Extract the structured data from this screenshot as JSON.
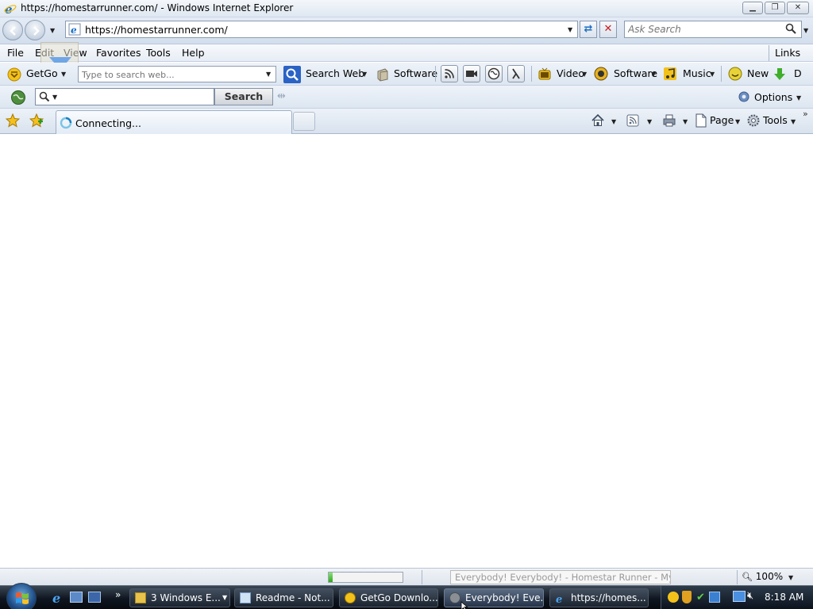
{
  "window": {
    "title": "https://homestarrunner.com/ - Windows Internet Explorer",
    "controls": [
      "minimize",
      "restore",
      "close"
    ]
  },
  "address_bar": {
    "url": "https://homestarrunner.com/",
    "search_placeholder": "Ask Search"
  },
  "menu": {
    "items": [
      "File",
      "Edit",
      "View",
      "Favorites",
      "Tools",
      "Help"
    ],
    "links_label": "Links"
  },
  "getgo_toolbar": {
    "brand_label": "GetGo",
    "search_placeholder": "Type to search web...",
    "search_web_label": "Search Web",
    "software_label": "Software",
    "video_label": "Video",
    "software2_label": "Software",
    "music_label": "Music",
    "new_label": "New",
    "overflow_label": "D"
  },
  "ask_toolbar": {
    "search_button_label": "Search",
    "options_label": "Options"
  },
  "tabs": {
    "active_tab_label": "Connecting...",
    "page_label": "Page",
    "tools_label": "Tools"
  },
  "status_bar": {
    "progress_fraction": 0.05,
    "tooltip_text": "Everybody! Everybody! - Homestar Runner - Mypal",
    "zoom_label": "100%"
  },
  "taskbar": {
    "items": [
      {
        "label": "3 Windows E...",
        "icon": "folder-icon",
        "active": false
      },
      {
        "label": "Readme - Not...",
        "icon": "notepad-icon",
        "active": false
      },
      {
        "label": "GetGo Downlo...",
        "icon": "getgo-icon",
        "active": false
      },
      {
        "label": "Everybody! Eve...",
        "icon": "mypal-icon",
        "active": true
      },
      {
        "label": "https://homes...",
        "icon": "ie-icon",
        "active": false
      }
    ],
    "clock": "8:18 AM"
  },
  "colors": {
    "chrome_blue": "#dde6f1",
    "taskbar_dark": "#0f1620",
    "progress_green": "#2fa81a"
  }
}
